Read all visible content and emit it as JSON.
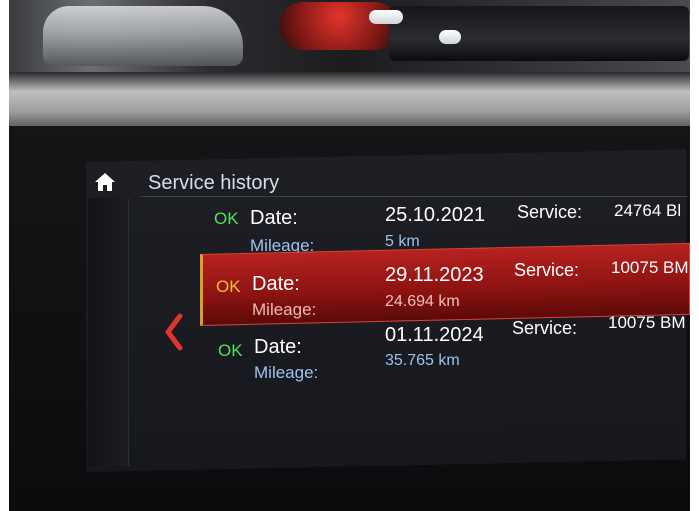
{
  "header": {
    "title": "Service history"
  },
  "icons": {
    "home": "home-icon",
    "back": "chevron-left-icon"
  },
  "rows": [
    {
      "status": "OK",
      "date_label": "Date:",
      "date": "25.10.2021",
      "mileage_label": "Mileage:",
      "mileage": "5 km",
      "service_label": "Service:",
      "service_value": "24764 Bl"
    },
    {
      "status": "OK",
      "date_label": "Date:",
      "date": "29.11.2023",
      "mileage_label": "Mileage:",
      "mileage": "24.694 km",
      "service_label": "Service:",
      "service_value": "10075 BM",
      "selected": true
    },
    {
      "status": "OK",
      "date_label": "Date:",
      "date": "01.11.2024",
      "mileage_label": "Mileage:",
      "mileage": "35.765 km",
      "service_label": "Service:",
      "service_value": "10075 BM"
    }
  ],
  "colors": {
    "ok": "#52e05a",
    "ok_selected": "#f0c233",
    "highlight": "#b62220",
    "accent_arrow": "#e0352c"
  }
}
